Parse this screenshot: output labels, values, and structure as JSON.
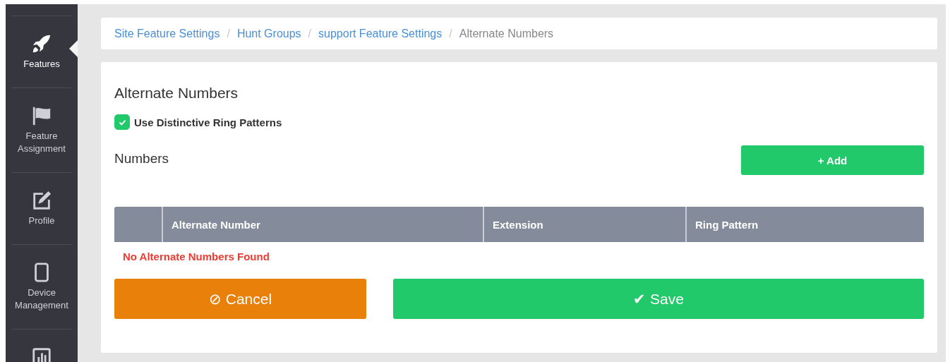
{
  "sidebar": {
    "items": [
      {
        "kind": "rocket",
        "label": "Features",
        "selected": true
      },
      {
        "kind": "flag",
        "label": "Feature Assignment",
        "selected": false
      },
      {
        "kind": "edit",
        "label": "Profile",
        "selected": false
      },
      {
        "kind": "tablet",
        "label": "Device Management",
        "selected": false
      },
      {
        "kind": "chart",
        "selected": false
      }
    ]
  },
  "breadcrumb": [
    {
      "label": "Site Feature Settings",
      "link": true
    },
    {
      "label": "/",
      "kind": "separator"
    },
    {
      "label": "Hunt Groups",
      "link": true
    },
    {
      "label": "/",
      "kind": "separator"
    },
    {
      "label": "support Feature Settings",
      "link": true
    },
    {
      "label": "/",
      "kind": "separator"
    },
    {
      "label": "Alternate Numbers",
      "link": false
    }
  ],
  "title": "Alternate Numbers",
  "checkbox": {
    "label": "Use Distinctive Ring Patterns",
    "checked": true
  },
  "numbers": {
    "heading": "Numbers",
    "add_button": "+ Add"
  },
  "table": {
    "columns": [
      "",
      "Alternate Number",
      "Extension",
      "Ring Pattern"
    ],
    "empty_message": "No Alternate Numbers Found"
  },
  "buttons": [
    {
      "kind": "cancel",
      "icon": "⊘",
      "label": "Cancel"
    },
    {
      "kind": "save",
      "icon": "✔",
      "label": "Save"
    }
  ]
}
